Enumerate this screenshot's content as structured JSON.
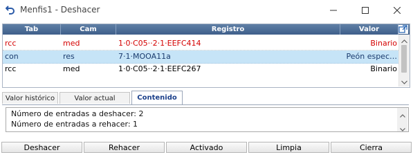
{
  "window": {
    "title": "Menfis1 - Deshacer",
    "icon": "undo-arrow-icon"
  },
  "grid": {
    "columns": [
      "Tab",
      "Cam",
      "Registro",
      "Valor"
    ],
    "rows": [
      {
        "tab": "rcc",
        "cam": "med",
        "registro": "1·0·C05··2·1·EEFC414",
        "valor": "Binario",
        "color": "#d40000"
      },
      {
        "tab": "con",
        "cam": "res",
        "registro": "7·1·MOOA11a",
        "valor": "Peón espec…",
        "color": "#1a3b6e",
        "selected": true
      },
      {
        "tab": "rcc",
        "cam": "med",
        "registro": "1·0·C05··2·1·EEFC267",
        "valor": "Binario",
        "color": "#000000"
      }
    ]
  },
  "tabs": [
    {
      "label": "Valor histórico"
    },
    {
      "label": "Valor actual"
    },
    {
      "label": "Contenido",
      "active": true
    }
  ],
  "content": {
    "line1": "Número de entradas a deshacer: 2",
    "line2": "Número de entradas a rehacer: 1"
  },
  "buttons": {
    "deshacer": "Deshacer",
    "rehacer": "Rehacer",
    "activado": "Activado",
    "limpia": "Limpia",
    "cierra": "Cierra"
  }
}
